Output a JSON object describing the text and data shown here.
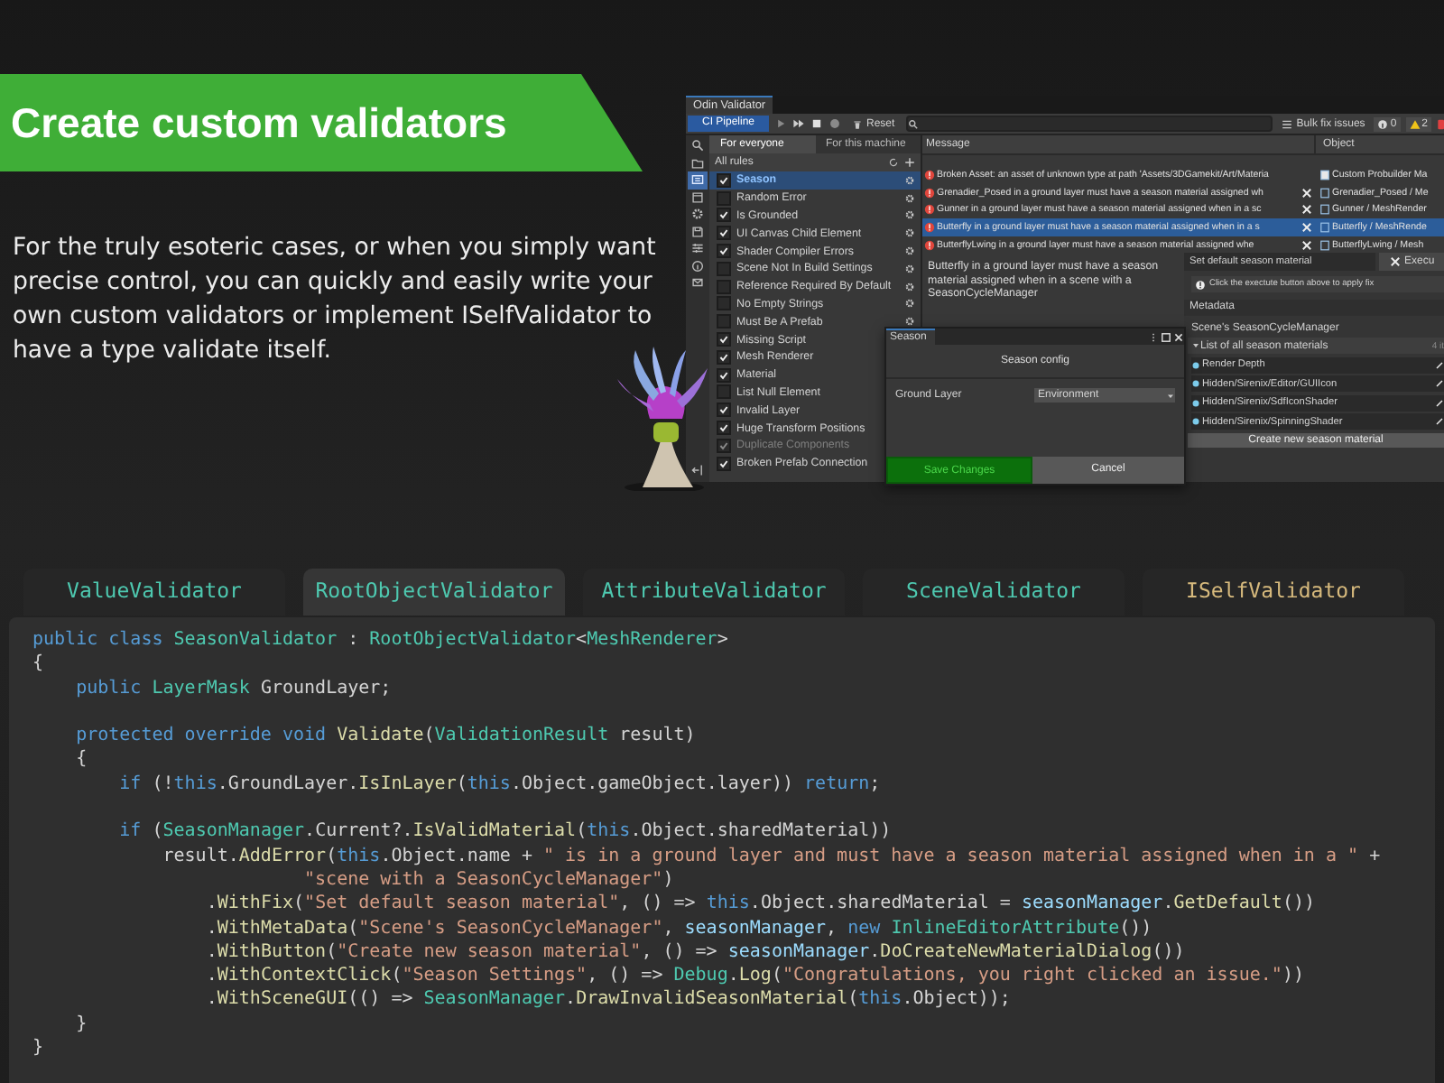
{
  "heading": "Create custom validators",
  "intro": "For the truly esoteric cases, or when you simply want precise control, you can quickly and easily write your own custom validators or implement ISelfValidator to have a type validate itself.",
  "editor": {
    "title": "Odin Validator",
    "pipeline": "CI Pipeline",
    "reset": "Reset",
    "bulk_fix": "Bulk fix issues",
    "counts": [
      {
        "kind": "info",
        "text": "0"
      },
      {
        "kind": "warning",
        "text": "2"
      },
      {
        "kind": "error"
      }
    ],
    "sidebar": [
      {
        "kind": "search",
        "selected": false
      },
      {
        "kind": "folder",
        "selected": false
      },
      {
        "kind": "list",
        "selected": true
      },
      {
        "kind": "window",
        "selected": false
      },
      {
        "kind": "gear",
        "selected": false
      },
      {
        "kind": "disk",
        "selected": false
      },
      {
        "kind": "sliders",
        "selected": false
      },
      {
        "kind": "info",
        "selected": false
      },
      {
        "kind": "mail",
        "selected": false
      }
    ],
    "scopes": [
      {
        "label": "For everyone",
        "selected": true
      },
      {
        "label": "For this machine",
        "selected": false
      }
    ],
    "rules_header": "All rules",
    "rules": [
      {
        "label": "Season",
        "checked": true,
        "selected": true,
        "disabled": false,
        "settings": true
      },
      {
        "label": "Random Error",
        "checked": false,
        "selected": false,
        "disabled": false,
        "settings": true
      },
      {
        "label": "Is Grounded",
        "checked": true,
        "selected": false,
        "disabled": false,
        "settings": true
      },
      {
        "label": "UI Canvas Child Element",
        "checked": true,
        "selected": false,
        "disabled": false,
        "settings": true
      },
      {
        "label": "Shader Compiler Errors",
        "checked": true,
        "selected": false,
        "disabled": false,
        "settings": true
      },
      {
        "label": "Scene Not In Build Settings",
        "checked": false,
        "selected": false,
        "disabled": false,
        "settings": true
      },
      {
        "label": "Reference Required By Default",
        "checked": false,
        "selected": false,
        "disabled": false,
        "settings": true
      },
      {
        "label": "No Empty Strings",
        "checked": false,
        "selected": false,
        "disabled": false,
        "settings": true
      },
      {
        "label": "Must Be A Prefab",
        "checked": false,
        "selected": false,
        "disabled": false,
        "settings": true
      },
      {
        "label": "Missing Script",
        "checked": true,
        "selected": false,
        "disabled": false,
        "settings": false
      },
      {
        "label": "Mesh Renderer",
        "checked": true,
        "selected": false,
        "disabled": false,
        "settings": false
      },
      {
        "label": "Material",
        "checked": true,
        "selected": false,
        "disabled": false,
        "settings": false
      },
      {
        "label": "List Null Element",
        "checked": false,
        "selected": false,
        "disabled": false,
        "settings": false
      },
      {
        "label": "Invalid Layer",
        "checked": true,
        "selected": false,
        "disabled": false,
        "settings": false
      },
      {
        "label": "Huge Transform Positions",
        "checked": true,
        "selected": false,
        "disabled": false,
        "settings": false
      },
      {
        "label": "Duplicate Components",
        "checked": true,
        "selected": false,
        "disabled": true,
        "settings": false
      },
      {
        "label": "Broken Prefab Connection",
        "checked": true,
        "selected": false,
        "disabled": false,
        "settings": false
      }
    ],
    "columns": [
      "Message",
      "Object"
    ],
    "issues": [
      {
        "message": "Broken Asset: an asset of unknown type at path 'Assets/3DGamekit/Art/Materia",
        "object": "Custom Probuilder Ma",
        "fixable": false,
        "selected": false
      },
      {
        "message": "Grenadier_Posed in a ground layer must have a season material assigned wh",
        "object": "Grenadier_Posed / Me",
        "fixable": true,
        "selected": false
      },
      {
        "message": "Gunner in a ground layer must have a season material assigned when in a sc",
        "object": "Gunner / MeshRender",
        "fixable": true,
        "selected": false
      },
      {
        "message": "Butterfly in a ground layer must have a season material assigned when in a s",
        "object": "Butterfly / MeshRende",
        "fixable": true,
        "selected": true
      },
      {
        "message": "ButterflyLwing in a ground layer must have a season material assigned whe",
        "object": "ButterflyLwing / Mesh",
        "fixable": true,
        "selected": false
      }
    ],
    "details": "Butterfly in a ground layer must have a season material assigned when in a scene with a SeasonCycleManager",
    "fix": {
      "name": "Set default season material",
      "execute": "Execu",
      "hint": "Click the exectute button above to apply fix"
    },
    "metadata": {
      "header": "Metadata",
      "title": "Scene's SeasonCycleManager",
      "list_label": "List of all season materials",
      "count": "4 it",
      "items": [
        "Render Depth",
        "Hidden/Sirenix/Editor/GUIIcon",
        "Hidden/Sirenix/SdfIconShader",
        "Hidden/Sirenix/SpinningShader"
      ],
      "button": "Create new season material"
    },
    "dialog": {
      "tab": "Season",
      "header": "Season config",
      "field_label": "Ground Layer",
      "field_value": "Environment",
      "save": "Save Changes",
      "cancel": "Cancel"
    }
  },
  "tabs": [
    {
      "label": "ValueValidator",
      "selected": false,
      "kind": "class"
    },
    {
      "label": "RootObjectValidator",
      "selected": true,
      "kind": "class"
    },
    {
      "label": "AttributeValidator",
      "selected": false,
      "kind": "class"
    },
    {
      "label": "SceneValidator",
      "selected": false,
      "kind": "class"
    },
    {
      "label": "ISelfValidator",
      "selected": false,
      "kind": "interface"
    }
  ],
  "code": [
    [
      [
        {
          "kind": "kw",
          "text": "public class "
        },
        {
          "kind": "type",
          "text": "SeasonValidator"
        },
        {
          "kind": "plain",
          "text": " : "
        },
        {
          "kind": "type",
          "text": "RootObjectValidator"
        },
        {
          "kind": "plain",
          "text": "<"
        },
        {
          "kind": "type",
          "text": "MeshRenderer"
        },
        {
          "kind": "plain",
          "text": ">"
        }
      ],
      [
        {
          "kind": "plain",
          "text": "{"
        }
      ],
      [
        {
          "kind": "kw",
          "text": "    public "
        },
        {
          "kind": "type",
          "text": "LayerMask"
        },
        {
          "kind": "plain",
          "text": " GroundLayer;"
        }
      ]
    ],
    [
      [
        {
          "kind": "kw",
          "text": "    protected override void "
        },
        {
          "kind": "fn",
          "text": "Validate"
        },
        {
          "kind": "plain",
          "text": "("
        },
        {
          "kind": "type",
          "text": "ValidationResult"
        },
        {
          "kind": "plain",
          "text": " result)"
        }
      ],
      [
        {
          "kind": "plain",
          "text": "    {"
        }
      ],
      [
        {
          "kind": "kw",
          "text": "        if"
        },
        {
          "kind": "plain",
          "text": " (!"
        },
        {
          "kind": "kw",
          "text": "this"
        },
        {
          "kind": "plain",
          "text": ".GroundLayer."
        },
        {
          "kind": "fn",
          "text": "IsInLayer"
        },
        {
          "kind": "plain",
          "text": "("
        },
        {
          "kind": "kw",
          "text": "this"
        },
        {
          "kind": "plain",
          "text": ".Object.gameObject.layer)) "
        },
        {
          "kind": "kw",
          "text": "return"
        },
        {
          "kind": "plain",
          "text": ";"
        }
      ]
    ],
    [
      [
        {
          "kind": "kw",
          "text": "        if"
        },
        {
          "kind": "plain",
          "text": " ("
        },
        {
          "kind": "type",
          "text": "SeasonManager"
        },
        {
          "kind": "plain",
          "text": ".Current?."
        },
        {
          "kind": "fn",
          "text": "IsValidMaterial"
        },
        {
          "kind": "plain",
          "text": "("
        },
        {
          "kind": "kw",
          "text": "this"
        },
        {
          "kind": "plain",
          "text": ".Object.sharedMaterial))"
        }
      ],
      [
        {
          "kind": "plain",
          "text": "            result."
        },
        {
          "kind": "fn",
          "text": "AddError"
        },
        {
          "kind": "plain",
          "text": "("
        },
        {
          "kind": "kw",
          "text": "this"
        },
        {
          "kind": "plain",
          "text": ".Object.name + "
        },
        {
          "kind": "str",
          "text": "\" is in a ground layer and must have a season material assigned when in a \""
        },
        {
          "kind": "plain",
          "text": " +"
        }
      ],
      [
        {
          "kind": "str",
          "text": "                         \"scene with a SeasonCycleManager\""
        },
        {
          "kind": "plain",
          "text": ")"
        }
      ],
      [
        {
          "kind": "plain",
          "text": "                ."
        },
        {
          "kind": "fn",
          "text": "WithFix"
        },
        {
          "kind": "plain",
          "text": "("
        },
        {
          "kind": "str",
          "text": "\"Set default season material\""
        },
        {
          "kind": "plain",
          "text": ", () => "
        },
        {
          "kind": "kw",
          "text": "this"
        },
        {
          "kind": "plain",
          "text": ".Object.sharedMaterial = "
        },
        {
          "kind": "var",
          "text": "seasonManager"
        },
        {
          "kind": "plain",
          "text": "."
        },
        {
          "kind": "fn",
          "text": "GetDefault"
        },
        {
          "kind": "plain",
          "text": "())"
        }
      ],
      [
        {
          "kind": "plain",
          "text": "                ."
        },
        {
          "kind": "fn",
          "text": "WithMetaData"
        },
        {
          "kind": "plain",
          "text": "("
        },
        {
          "kind": "str",
          "text": "\"Scene's SeasonCycleManager\""
        },
        {
          "kind": "plain",
          "text": ", "
        },
        {
          "kind": "var",
          "text": "seasonManager"
        },
        {
          "kind": "plain",
          "text": ", "
        },
        {
          "kind": "kw",
          "text": "new "
        },
        {
          "kind": "type",
          "text": "InlineEditorAttribute"
        },
        {
          "kind": "plain",
          "text": "())"
        }
      ],
      [
        {
          "kind": "plain",
          "text": "                ."
        },
        {
          "kind": "fn",
          "text": "WithButton"
        },
        {
          "kind": "plain",
          "text": "("
        },
        {
          "kind": "str",
          "text": "\"Create new season material\""
        },
        {
          "kind": "plain",
          "text": ", () => "
        },
        {
          "kind": "var",
          "text": "seasonManager"
        },
        {
          "kind": "plain",
          "text": "."
        },
        {
          "kind": "fn",
          "text": "DoCreateNewMaterialDialog"
        },
        {
          "kind": "plain",
          "text": "())"
        }
      ],
      [
        {
          "kind": "plain",
          "text": "                ."
        },
        {
          "kind": "fn",
          "text": "WithContextClick"
        },
        {
          "kind": "plain",
          "text": "("
        },
        {
          "kind": "str",
          "text": "\"Season Settings\""
        },
        {
          "kind": "plain",
          "text": ", () => "
        },
        {
          "kind": "type",
          "text": "Debug"
        },
        {
          "kind": "plain",
          "text": "."
        },
        {
          "kind": "fn",
          "text": "Log"
        },
        {
          "kind": "plain",
          "text": "("
        },
        {
          "kind": "str",
          "text": "\"Congratulations, you right clicked an issue.\""
        },
        {
          "kind": "plain",
          "text": "))"
        }
      ],
      [
        {
          "kind": "plain",
          "text": "                ."
        },
        {
          "kind": "fn",
          "text": "WithSceneGUI"
        },
        {
          "kind": "plain",
          "text": "(() => "
        },
        {
          "kind": "type",
          "text": "SeasonManager"
        },
        {
          "kind": "plain",
          "text": "."
        },
        {
          "kind": "fn",
          "text": "DrawInvalidSeasonMaterial"
        },
        {
          "kind": "plain",
          "text": "("
        },
        {
          "kind": "kw",
          "text": "this"
        },
        {
          "kind": "plain",
          "text": ".Object));"
        }
      ],
      [
        {
          "kind": "plain",
          "text": "    }"
        }
      ],
      [
        {
          "kind": "plain",
          "text": "}"
        }
      ]
    ]
  ]
}
